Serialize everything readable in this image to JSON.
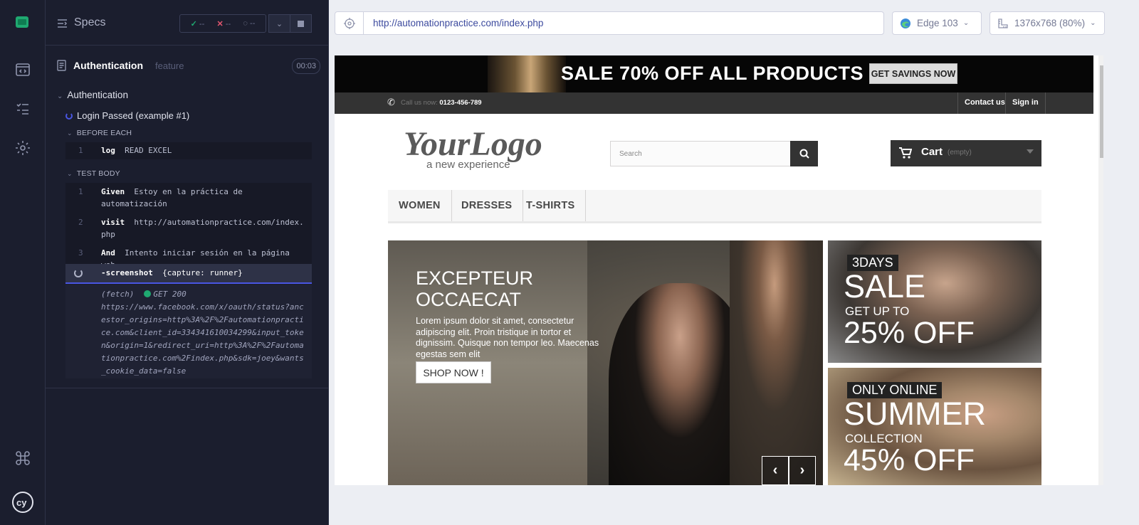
{
  "runner": {
    "specs_label": "Specs",
    "stats": {
      "passed": "--",
      "failed": "--",
      "pending": "--"
    },
    "feature": {
      "name": "Authentication",
      "tag": "feature",
      "duration": "00:03"
    },
    "suite": "Authentication",
    "test": "Login Passed (example #1)",
    "before_each": {
      "label": "BEFORE EACH",
      "commands": [
        {
          "num": "1",
          "name": "log",
          "msg": "READ EXCEL"
        }
      ]
    },
    "test_body": {
      "label": "TEST BODY",
      "commands": [
        {
          "num": "1",
          "name": "Given",
          "msg": "Estoy en la práctica de automatización"
        },
        {
          "num": "2",
          "name": "visit",
          "msg": "http://automationpractice.com/index.php"
        },
        {
          "num": "3",
          "name": "And",
          "msg": "Intento iniciar sesión en la página web"
        }
      ],
      "current": {
        "name": "-screenshot",
        "msg": "{capture: runner}"
      },
      "fetch": {
        "label": "(fetch)",
        "method": "GET 200",
        "url": "https://www.facebook.com/x/oauth/status?ancestor_origins=http%3A%2F%2Fautomationpractice.com&client_id=334341610034299&input_token&origin=1&redirect_uri=http%3A%2F%2Fautomationpractice.com%2Findex.php&sdk=joey&wants_cookie_data=false"
      }
    }
  },
  "aut": {
    "url": "http://automationpractice.com/index.php",
    "browser": "Edge 103",
    "viewport": "1376x768 (80%)"
  },
  "site": {
    "banner": {
      "text": "SALE 70% OFF ALL PRODUCTS",
      "button": "GET SAVINGS NOW"
    },
    "nav": {
      "call_label": "Call us now:",
      "phone": "0123-456-789",
      "contact": "Contact us",
      "signin": "Sign in"
    },
    "logo": {
      "main": "YourLogo",
      "sub": "a new experience"
    },
    "search_placeholder": "Search",
    "cart": {
      "label": "Cart",
      "status": "(empty)"
    },
    "menu": [
      "WOMEN",
      "DRESSES",
      "T-SHIRTS"
    ],
    "hero": {
      "title_line1": "EXCEPTEUR",
      "title_line2": "OCCAECAT",
      "text": "Lorem ipsum dolor sit amet, consectetur adipiscing elit. Proin tristique in tortor et dignissim. Quisque non tempor leo. Maecenas egestas sem elit",
      "button": "SHOP NOW !"
    },
    "tile1": {
      "tag": "3DAYS",
      "big": "SALE",
      "small": "GET UP TO",
      "pct": "25% OFF"
    },
    "tile2": {
      "tag": "ONLY ONLINE",
      "big": "SUMMER",
      "small": "COLLECTION",
      "pct": "45% OFF"
    }
  },
  "colors": {
    "accent": "#4956e3",
    "pass": "#1fa971",
    "fail": "#e45770",
    "panel": "#1b1e2e"
  }
}
